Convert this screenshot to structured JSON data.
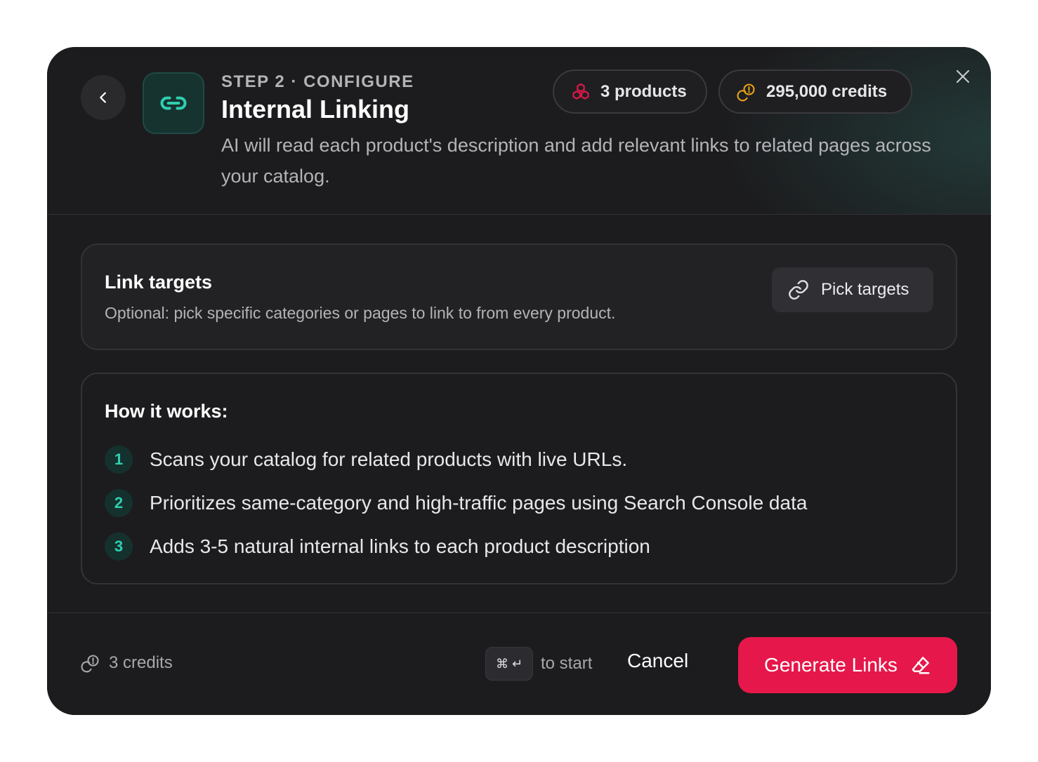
{
  "header": {
    "step_label": "STEP 2 · CONFIGURE",
    "title": "Internal Linking",
    "description": "AI will read each product's description and add relevant links to related pages across your catalog.",
    "chips": {
      "products": "3 products",
      "credits": "295,000 credits"
    },
    "icons": {
      "back": "chevron-left-icon",
      "feature": "link-icon",
      "products": "cubes-icon",
      "credits": "coins-icon",
      "close": "close-icon"
    }
  },
  "link_targets": {
    "title": "Link targets",
    "subtitle": "Optional: pick specific categories or pages to link to from every product.",
    "button_label": "Pick targets",
    "button_icon": "link-icon"
  },
  "how_it_works": {
    "title": "How it works:",
    "steps": [
      {
        "num": "1",
        "text": "Scans your catalog for related products with live URLs."
      },
      {
        "num": "2",
        "text": "Prioritizes same-category and high-traffic pages using Search Console data"
      },
      {
        "num": "3",
        "text": "Adds 3-5 natural internal links to each product description"
      }
    ]
  },
  "footer": {
    "credits_label": "3 credits",
    "shortcut_keys": "⌘ ↵",
    "shortcut_hint": "to start",
    "cancel_label": "Cancel",
    "generate_label": "Generate Links",
    "generate_icon": "eraser-icon"
  },
  "colors": {
    "accent": "#e6174a",
    "teal": "#2fcfb1",
    "products_icon": "#e6174a",
    "credits_icon": "#e8a21a",
    "background": "#1c1c1e"
  }
}
